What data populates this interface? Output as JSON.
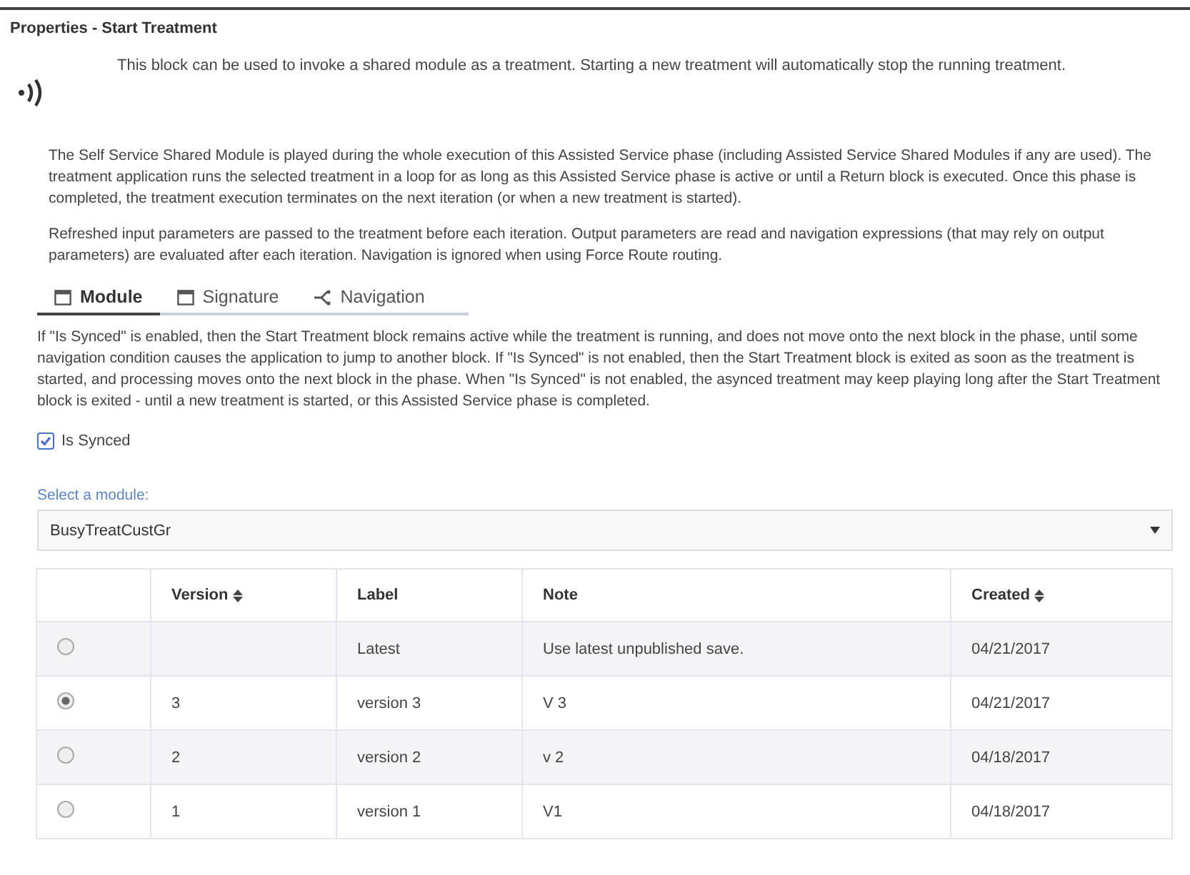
{
  "title": "Properties - Start Treatment",
  "intro": "This block can be used to invoke a shared module as a treatment. Starting a new treatment will automatically stop the running treatment.",
  "paragraphs": [
    "The Self Service Shared Module is played during the whole execution of this Assisted Service phase (including Assisted Service Shared Modules if any are used). The treatment application runs the selected treatment in a loop for as long as this Assisted Service phase is active or until a Return block is executed. Once this phase is completed, the treatment execution terminates on the next iteration (or when a new treatment is started).",
    "Refreshed input parameters are passed to the treatment before each iteration. Output parameters are read and navigation expressions (that may rely on output parameters) are evaluated after each iteration. Navigation is ignored when using Force Route routing."
  ],
  "tabs": [
    {
      "label": "Module",
      "kind": "window",
      "selected": true
    },
    {
      "label": "Signature",
      "kind": "window",
      "selected": false
    },
    {
      "label": "Navigation",
      "kind": "branch",
      "selected": false
    }
  ],
  "description": "If \"Is Synced\" is enabled, then the Start Treatment block remains active while the treatment is running, and does not move onto the next block in the phase, until some navigation condition causes the application to jump to another block. If \"Is Synced\" is not enabled, then the Start Treatment block is exited as soon as the treatment is started, and processing moves onto the next block in the phase. When \"Is Synced\" is not enabled, the asynced treatment may keep playing long after the Start Treatment block is exited - until a new treatment is started, or this Assisted Service phase is completed.",
  "is_synced": {
    "label": "Is Synced",
    "checked": true
  },
  "module_select": {
    "label": "Select a module:",
    "value": "BusyTreatCustGr"
  },
  "table": {
    "columns": [
      {
        "label": "Version",
        "sortable": true
      },
      {
        "label": "Label",
        "sortable": false
      },
      {
        "label": "Note",
        "sortable": false
      },
      {
        "label": "Created",
        "sortable": true
      }
    ],
    "rows": [
      {
        "selected": false,
        "cells": [
          "",
          "Latest",
          "Use latest unpublished save.",
          "04/21/2017"
        ]
      },
      {
        "selected": true,
        "cells": [
          "3",
          "version 3",
          "V 3",
          "04/21/2017"
        ]
      },
      {
        "selected": false,
        "cells": [
          "2",
          "version 2",
          "v 2",
          "04/18/2017"
        ]
      },
      {
        "selected": false,
        "cells": [
          "1",
          "version 1",
          "V1",
          "04/18/2017"
        ]
      }
    ]
  }
}
